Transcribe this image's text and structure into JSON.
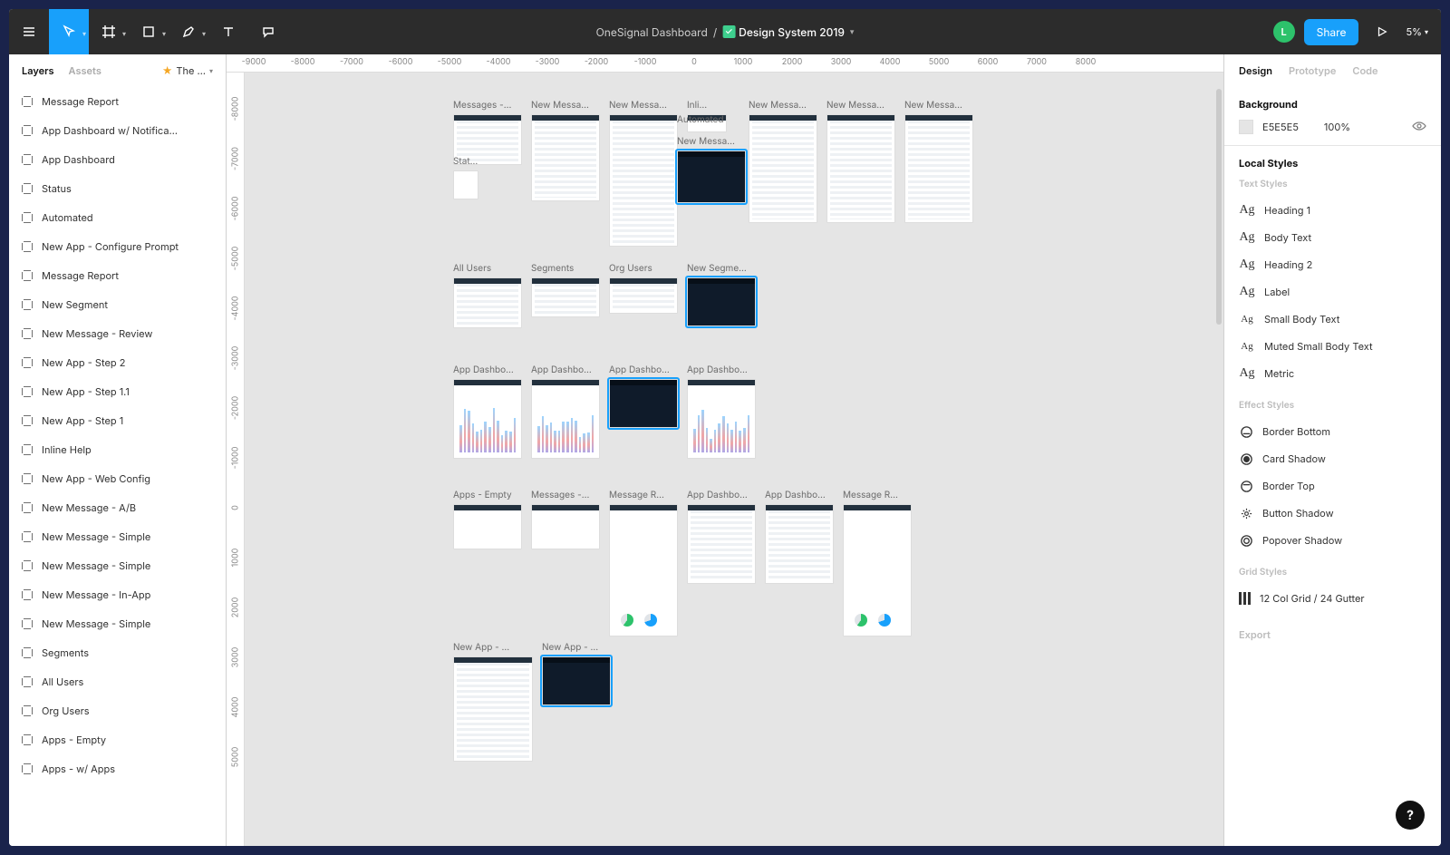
{
  "toolbar": {
    "project": "OneSignal Dashboard",
    "file": "Design System 2019",
    "share_label": "Share",
    "avatar_initial": "L",
    "zoom": "5%"
  },
  "left": {
    "tab_layers": "Layers",
    "tab_assets": "Assets",
    "page_label": "The …",
    "items": [
      "Message Report",
      "App Dashboard w/ Notifica…",
      "App Dashboard",
      "Status",
      "Automated",
      "New App - Configure Prompt",
      "Message Report",
      " New Segment",
      "New Message - Review",
      "New App - Step 2",
      "New App - Step 1.1",
      "New App - Step 1",
      "Inline Help",
      "New App - Web Config",
      "New Message - A/B",
      "New Message - Simple",
      "New Message - Simple",
      "New Message - In-App",
      "New Message - Simple",
      "Segments",
      "All Users",
      "Org Users",
      "Apps - Empty",
      "Apps - w/ Apps"
    ]
  },
  "ruler": {
    "h": [
      "-9000",
      "-8000",
      "-7000",
      "-6000",
      "-5000",
      "-4000",
      "-3000",
      "-2000",
      "-1000",
      "0",
      "1000",
      "2000",
      "3000",
      "4000",
      "5000",
      "6000",
      "7000",
      "8000"
    ],
    "v": [
      "-8000",
      "-7000",
      "-6000",
      "-5000",
      "-4000",
      "-3000",
      "-2000",
      "-1000",
      "0",
      "1000",
      "2000",
      "3000",
      "4000",
      "5000"
    ]
  },
  "canvas": {
    "row1": [
      "Messages -…",
      "New Messa…",
      "New Messa…",
      "Inli…"
    ],
    "row1b": [
      "New Messa…",
      "New Messa…",
      "New Messa…"
    ],
    "row1_star": "Stat…",
    "row1_auto": "Automated",
    "row1_newmsg": "New Messa…",
    "row2": [
      "All Users",
      "Segments",
      "Org Users",
      "New Segme…"
    ],
    "row3": [
      "App Dashbo…",
      "App Dashbo…",
      "App Dashbo…",
      "App Dashbo…"
    ],
    "row4": [
      "Apps - Empty",
      "Messages -…",
      "Message R…",
      "App Dashbo…",
      "App Dashbo…",
      "Message R…"
    ],
    "row5": [
      "New App - …",
      "New App - …"
    ]
  },
  "right": {
    "tab_design": "Design",
    "tab_proto": "Prototype",
    "tab_code": "Code",
    "bg_title": "Background",
    "bg_hex": "E5E5E5",
    "bg_op": "100%",
    "local_styles": "Local Styles",
    "text_styles": "Text Styles",
    "texts": [
      "Heading 1",
      "Body Text",
      "Heading 2",
      "Label",
      "Small Body Text",
      "Muted Small Body Text",
      "Metric"
    ],
    "effect_styles": "Effect Styles",
    "effects": [
      "Border Bottom",
      "Card Shadow",
      "Border Top",
      "Button Shadow",
      "Popover Shadow"
    ],
    "grid_styles": "Grid Styles",
    "grids": [
      "12 Col Grid / 24 Gutter"
    ],
    "export": "Export"
  }
}
